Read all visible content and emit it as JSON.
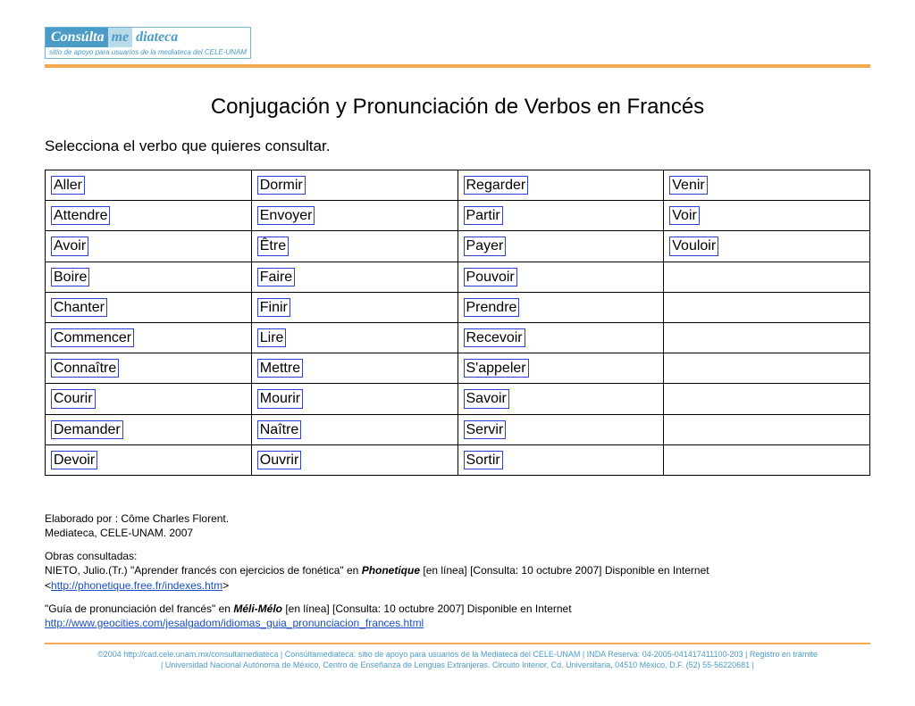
{
  "logo": {
    "seg1": "Consúlta",
    "seg2": "me",
    "seg3": "diateca",
    "subtitle": "sitio de apoyo para usuarios de la mediateca del CELE-UNAM"
  },
  "title": "Conjugación y Pronunciación de Verbos en Francés",
  "instruction": "Selecciona el verbo que quieres consultar.",
  "verbs": {
    "rows": [
      [
        "Aller",
        "Dormir",
        "Regarder",
        "Venir"
      ],
      [
        "Attendre",
        "Envoyer",
        "Partir",
        "Voir"
      ],
      [
        "Avoir",
        "Être",
        "Payer",
        "Vouloir"
      ],
      [
        "Boire",
        "Faire",
        "Pouvoir",
        ""
      ],
      [
        "Chanter",
        "Finir",
        "Prendre",
        ""
      ],
      [
        "Commencer",
        "Lire",
        "Recevoir",
        ""
      ],
      [
        "Connaître",
        "Mettre",
        "S'appeler",
        ""
      ],
      [
        "Courir",
        "Mourir",
        "Savoir",
        ""
      ],
      [
        "Demander",
        "Naître",
        "Servir",
        ""
      ],
      [
        "Devoir",
        "Ouvrir",
        "Sortir",
        ""
      ]
    ]
  },
  "credits": {
    "line1": "Elaborado por : Côme Charles Florent.",
    "line2": "Mediateca, CELE-UNAM. 2007",
    "obras_label": "Obras consultadas:",
    "ref1_pre": "NIETO, Julio.(Tr.) \"Aprender francés con ejercicios de fonética\" en ",
    "ref1_src": "Phonetique",
    "ref1_post": " [en línea]  [Consulta: 10 octubre 2007] Disponible en Internet",
    "ref1_link_open": "<",
    "ref1_link": "http://phonetique.free.fr/indexes.htm",
    "ref1_link_close": ">",
    "ref2_pre": "\"Guía de pronunciación del francés\" en ",
    "ref2_src": "Méli-Mélo",
    "ref2_post": " [en línea]  [Consulta: 10 octubre 2007] Disponible en Internet",
    "ref2_link": "http://www.geocities.com/jesalgadom/idiomas_guia_pronunciacion_frances.html"
  },
  "footer": {
    "line1": "©2004 http://cad.cele.unam.mx/consultamediateca | Consúltamediateca: sitio de apoyo para usuarios de la Mediateca del CELE-UNAM | INDA Reserva: 04-2005-041417411100-203 | Registro en trámite",
    "line2": "| Universidad Nacional Autónoma de México, Centro de Enseñanza de Lenguas Extranjeras. Circuito Interior, Cd. Universitaria, 04510 México, D.F. (52) 55-56220681 |"
  }
}
